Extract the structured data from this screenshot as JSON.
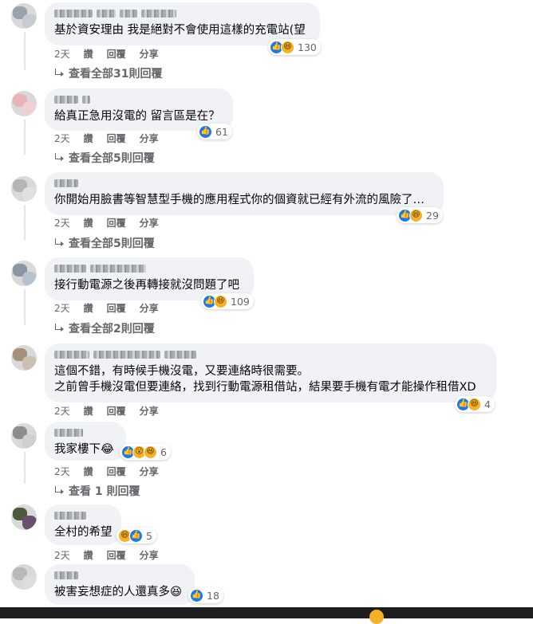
{
  "comments": [
    {
      "text_lines": [
        "基於資安理由 我是絕對不會使用這樣的充電站(望"
      ],
      "reactions": [
        "like",
        "haha"
      ],
      "reaction_count": "130",
      "time": "2天",
      "like_label": "讚",
      "reply_label": "回覆",
      "share_label": "分享",
      "replies_label": "查看全部31則回覆"
    },
    {
      "text_lines": [
        "給真正急用沒電的 留言區是在？"
      ],
      "reactions": [
        "like"
      ],
      "reaction_count": "61",
      "time": "2天",
      "like_label": "讚",
      "reply_label": "回覆",
      "share_label": "分享",
      "replies_label": "查看全部5則回覆"
    },
    {
      "text_lines": [
        "你開始用臉書等智慧型手機的應用程式你的個資就已經有外流的風險了…"
      ],
      "reactions": [
        "like",
        "haha"
      ],
      "reaction_count": "29",
      "time": "2天",
      "like_label": "讚",
      "reply_label": "回覆",
      "share_label": "分享",
      "replies_label": "查看全部5則回覆"
    },
    {
      "text_lines": [
        "接行動電源之後再轉接就沒問題了吧"
      ],
      "reactions": [
        "like",
        "haha"
      ],
      "reaction_count": "109",
      "time": "2天",
      "like_label": "讚",
      "reply_label": "回覆",
      "share_label": "分享",
      "replies_label": "查看全部2則回覆"
    },
    {
      "text_lines": [
        "這個不錯，有時候手機沒電，又要連絡時很需要。",
        "之前曾手機沒電但要連絡，找到行動電源租借站，結果要手機有電才能操作租借XD"
      ],
      "reactions": [
        "like",
        "haha"
      ],
      "reaction_count": "4",
      "time": "2天",
      "like_label": "讚",
      "reply_label": "回覆",
      "share_label": "分享"
    },
    {
      "text_lines": [
        "我家樓下😂"
      ],
      "reactions": [
        "like",
        "wow",
        "haha"
      ],
      "reaction_count": "6",
      "time": "2天",
      "like_label": "讚",
      "reply_label": "回覆",
      "share_label": "分享",
      "replies_label": "查看 1 則回覆"
    },
    {
      "text_lines": [
        "全村的希望"
      ],
      "reactions": [
        "haha",
        "like"
      ],
      "reaction_count": "5",
      "time": "2天",
      "like_label": "讚",
      "reply_label": "回覆",
      "share_label": "分享"
    },
    {
      "text_lines": [
        "被害妄想症的人還真多😆"
      ],
      "reactions": [
        "like"
      ],
      "reaction_count": "18"
    }
  ],
  "icons": {
    "like": "like-icon",
    "haha": "haha-icon",
    "wow": "wow-icon",
    "reply_arrow": "reply-arrow-icon"
  },
  "colors": {
    "bubble_bg": "#f0f2f5",
    "meta_text": "#65676b",
    "like_blue": "#1877f2",
    "emoji_yellow": "#f7b125"
  }
}
